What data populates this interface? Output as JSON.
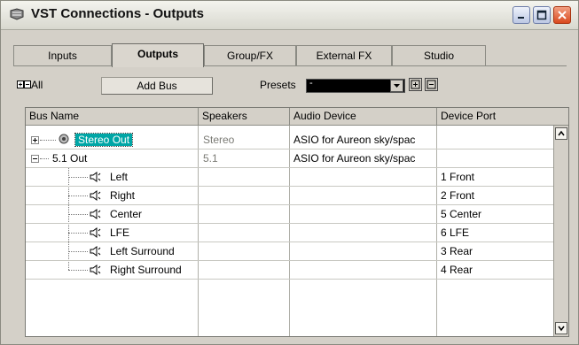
{
  "window": {
    "title": "VST Connections - Outputs"
  },
  "tabs": [
    {
      "label": "Inputs"
    },
    {
      "label": "Outputs",
      "active": true
    },
    {
      "label": "Group/FX"
    },
    {
      "label": "External FX"
    },
    {
      "label": "Studio"
    }
  ],
  "toolbar": {
    "all_label": "All",
    "add_bus_label": "Add Bus",
    "presets_label": "Presets",
    "presets_value": "-"
  },
  "table": {
    "columns": [
      "Bus Name",
      "Speakers",
      "Audio Device",
      "Device Port"
    ],
    "rows": [
      {
        "name": "Stereo Out",
        "speakers": "Stereo",
        "device": "ASIO for Aureon sky/spac",
        "port": ""
      },
      {
        "name": "5.1 Out",
        "speakers": "5.1",
        "device": "ASIO for Aureon sky/spac",
        "port": ""
      },
      {
        "name": "Left",
        "speakers": "",
        "device": "",
        "port": "1 Front"
      },
      {
        "name": "Right",
        "speakers": "",
        "device": "",
        "port": "2 Front"
      },
      {
        "name": "Center",
        "speakers": "",
        "device": "",
        "port": "5 Center"
      },
      {
        "name": "LFE",
        "speakers": "",
        "device": "",
        "port": "6 LFE"
      },
      {
        "name": "Left Surround",
        "speakers": "",
        "device": "",
        "port": "3 Rear"
      },
      {
        "name": "Right Surround",
        "speakers": "",
        "device": "",
        "port": "4 Rear"
      }
    ]
  }
}
